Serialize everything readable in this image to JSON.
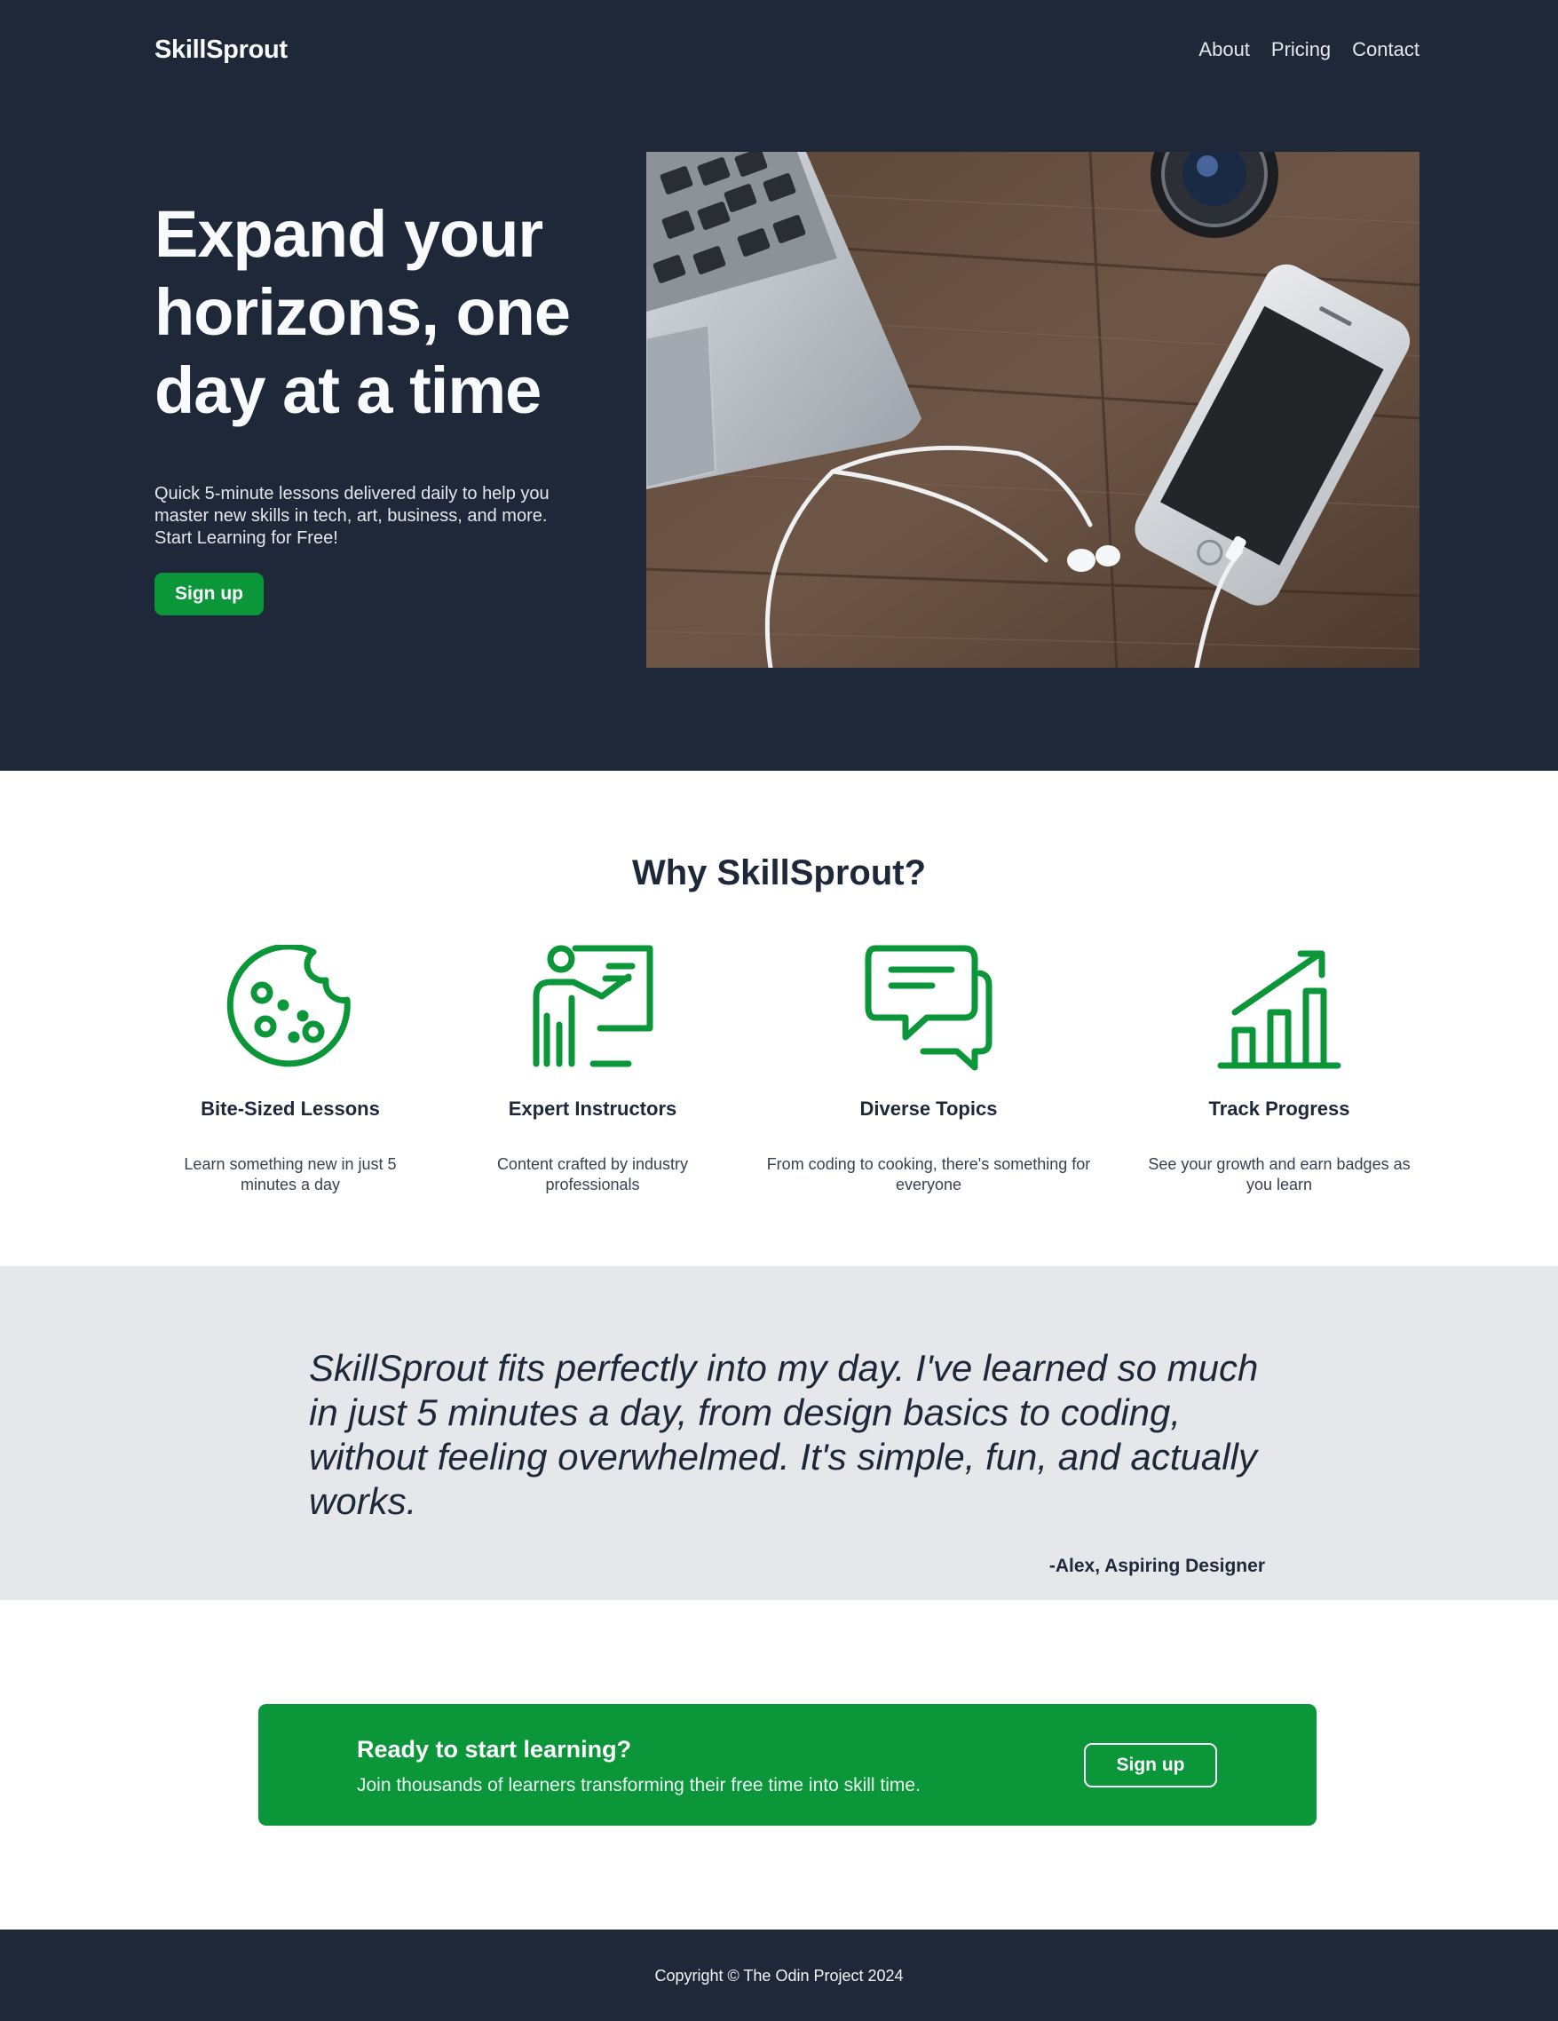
{
  "header": {
    "logo": "SkillSprout",
    "nav": [
      {
        "label": "About"
      },
      {
        "label": "Pricing"
      },
      {
        "label": "Contact"
      }
    ]
  },
  "hero": {
    "title": "Expand your horizons, one day at a time",
    "subtitle": "Quick 5-minute lessons delivered daily to help you master new skills in tech, art, business, and more. Start Learning for Free!",
    "button_label": "Sign up",
    "image_description": "laptop-phone-earphones-camera-on-wooden-desk"
  },
  "features": {
    "title": "Why SkillSprout?",
    "items": [
      {
        "icon": "cookie-icon",
        "title": "Bite-Sized Lessons",
        "description": "Learn something new in just 5 minutes a day"
      },
      {
        "icon": "teacher-icon",
        "title": "Expert Instructors",
        "description": "Content crafted by industry professionals"
      },
      {
        "icon": "chat-icon",
        "title": "Diverse Topics",
        "description": "From coding to cooking, there's something for everyone"
      },
      {
        "icon": "chart-growth-icon",
        "title": "Track Progress",
        "description": "See your growth and earn badges as you learn"
      }
    ]
  },
  "testimonial": {
    "quote": "SkillSprout fits perfectly into my day. I've learned so much in just 5 minutes a day, from design basics to coding, without feeling overwhelmed. It's simple, fun, and actually works.",
    "author": "-Alex, Aspiring Designer"
  },
  "cta": {
    "heading": "Ready to start learning?",
    "text": "Join thousands of learners transforming their free time into skill time.",
    "button_label": "Sign up"
  },
  "footer": {
    "copyright": "Copyright © The Odin Project 2024"
  },
  "colors": {
    "dark": "#1f2839",
    "accent": "#0b9639",
    "light_gray": "#e5e7eb"
  }
}
